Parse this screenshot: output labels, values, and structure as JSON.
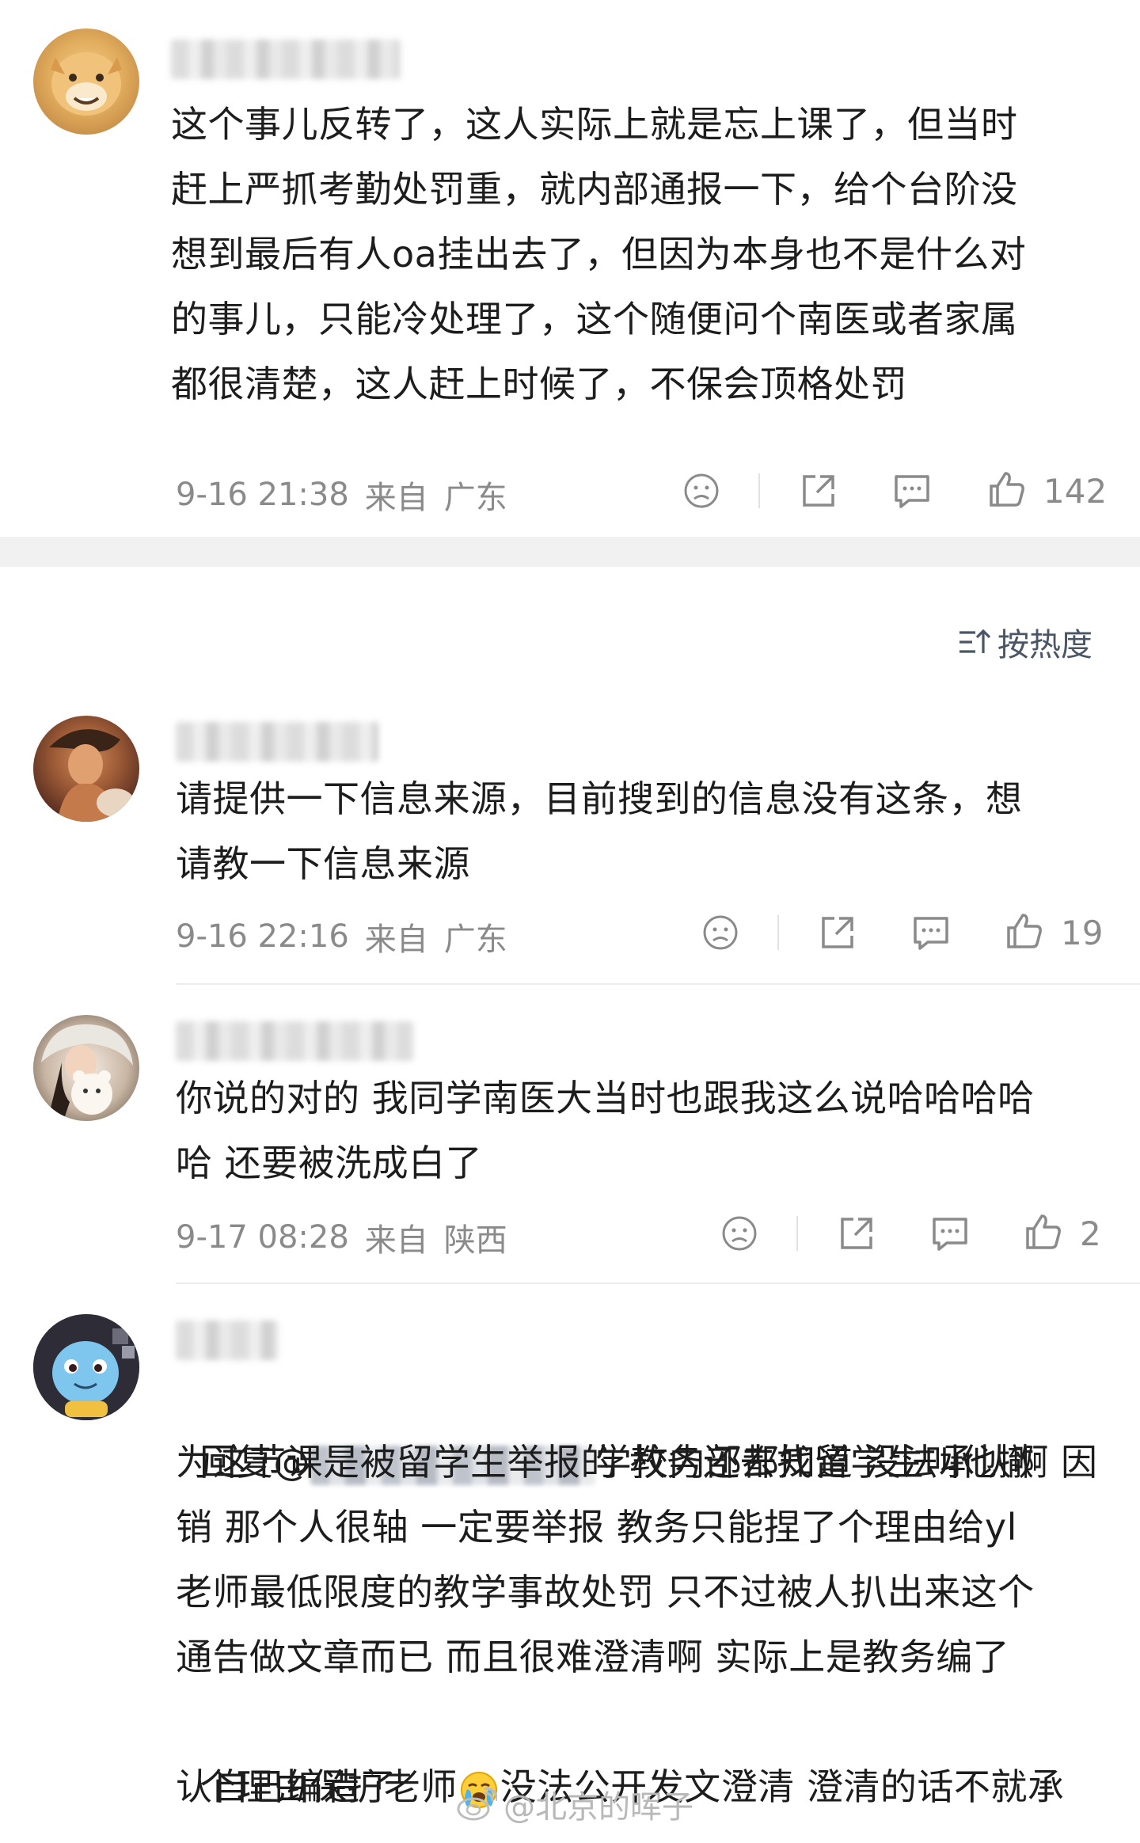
{
  "comments": [
    {
      "text": "这个事儿反转了，这人实际上就是忘上课了，但当时\n赶上严抓考勤处罚重，就内部通报一下，给个台阶没\n想到最后有人oa挂出去了，但因为本身也不是什么对\n的事儿，只能冷处理了，这个随便问个南医或者家属\n都很清楚，这人赶上时候了，不保会顶格处罚",
      "time": "9-16 21:38",
      "from_label": "来自",
      "location": "广东",
      "likes": "142"
    },
    {
      "text": "请提供一下信息来源，目前搜到的信息没有这条，想\n请教一下信息来源",
      "time": "9-16 22:16",
      "from_label": "来自",
      "location": "广东",
      "likes": "19"
    },
    {
      "text": "你说的对的 我同学南医大当时也跟我这么说哈哈哈哈\n哈 还要被洗成白了",
      "time": "9-17 08:28",
      "from_label": "来自",
      "location": "陕西",
      "likes": "2"
    },
    {
      "reply_prefix": "回复@",
      "reply_rest": "学校内部都知道 没法承认啊 因",
      "text": "为这节课是被留学生举报的 教务还去找留学生叫他撤\n销 那个人很轴 一定要举报 教务只能捏了个理由给yl\n老师最低限度的教学事故处罚 只不过被人扒出来这个\n通告做文章而已 而且很难澄清啊 实际上是教务编了",
      "text_last_a": "个理由保护老师",
      "text_last_b": "没法公开发文澄清 澄清的话不就承",
      "text_end": "认自己编造了"
    }
  ],
  "sort_label": "按热度",
  "watermark": "@北京的晖子",
  "icons": [
    "dislike-icon",
    "share-icon",
    "comment-icon",
    "like-icon",
    "sort-icon",
    "crying-emoji-icon",
    "weibo-logo-icon"
  ],
  "colors": {
    "meta_text": "#8a8a8a",
    "body_text": "#1d1d1d",
    "sort_text": "#4a5566",
    "band": "#f1f1f1"
  }
}
